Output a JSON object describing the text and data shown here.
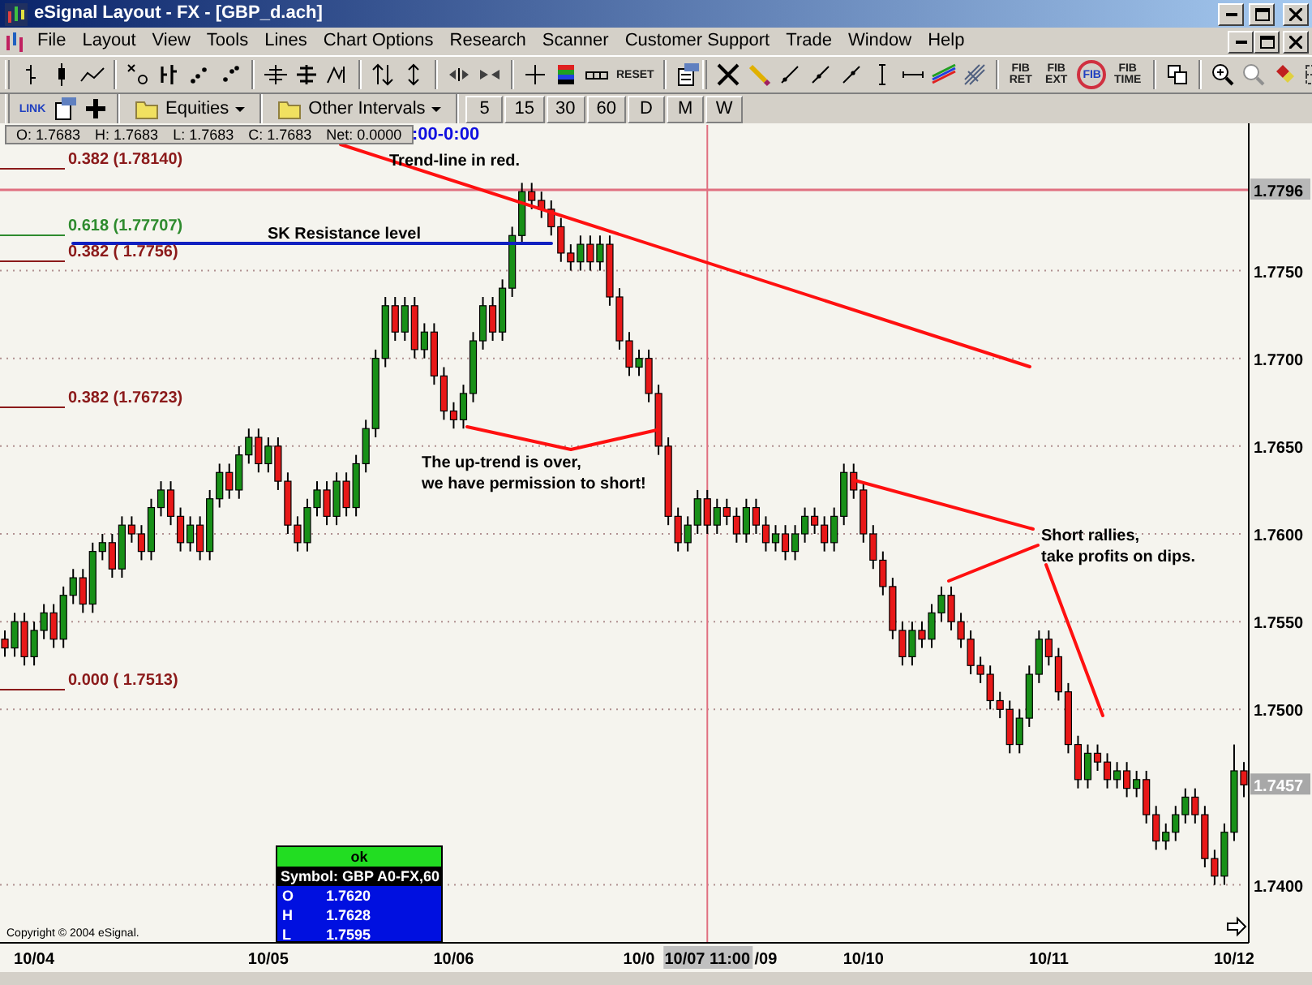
{
  "window": {
    "title": "eSignal Layout - FX - [GBP_d.ach]"
  },
  "menu": [
    "File",
    "Layout",
    "View",
    "Tools",
    "Lines",
    "Chart Options",
    "Research",
    "Scanner",
    "Customer Support",
    "Trade",
    "Window",
    "Help"
  ],
  "chart_toolbar": {
    "reset_label": "RESET"
  },
  "drawing_toolbar": {
    "fib_buttons": [
      "FIB RET",
      "FIB EXT",
      "FIB",
      "FIB TIME"
    ]
  },
  "interval_toolbar": {
    "link_label": "LINK",
    "symbol_list": "Equities",
    "interval_menu": "Other Intervals",
    "intervals": [
      "5",
      "15",
      "30",
      "60",
      "D",
      "M",
      "W"
    ]
  },
  "quote_bar": {
    "items": [
      "O: 1.7683",
      "H: 1.7683",
      "L: 1.7683",
      "C: 1.7683",
      "Net: 0.0000"
    ],
    "time_range": ":00-0:00"
  },
  "chart": {
    "chart_data": {
      "type": "candlestick",
      "grid": true,
      "ylim": [
        1.7367,
        1.7833
      ],
      "categories": [
        null,
        null,
        null,
        "10/04",
        null,
        null,
        null,
        null,
        null,
        null,
        null,
        null,
        null,
        null,
        null,
        null,
        null,
        null,
        null,
        null,
        null,
        null,
        null,
        null,
        null,
        null,
        null,
        "10/05",
        null,
        null,
        null,
        null,
        null,
        null,
        null,
        null,
        null,
        null,
        null,
        null,
        null,
        null,
        null,
        null,
        null,
        null,
        "10/06",
        null,
        null,
        null,
        null,
        null,
        null,
        null,
        null,
        null,
        null,
        null,
        null,
        null,
        null,
        null,
        null,
        null,
        null,
        "10/0",
        null,
        null,
        null,
        null,
        null,
        null,
        null,
        null,
        null,
        null,
        null,
        null,
        "/09",
        null,
        null,
        null,
        null,
        null,
        null,
        null,
        null,
        null,
        "10/10",
        null,
        null,
        null,
        null,
        null,
        null,
        null,
        null,
        null,
        null,
        null,
        null,
        null,
        null,
        null,
        null,
        null,
        null,
        "10/11",
        null,
        null,
        null,
        null,
        null,
        null,
        null,
        null,
        null,
        null,
        null,
        null,
        null,
        null,
        null,
        null,
        null,
        null,
        "10/12",
        null
      ],
      "ohlc": [
        [
          1.754,
          1.7545,
          1.753,
          1.7535
        ],
        [
          1.7535,
          1.7555,
          1.753,
          1.755
        ],
        [
          1.755,
          1.7555,
          1.7525,
          1.753
        ],
        [
          1.753,
          1.755,
          1.7525,
          1.7545
        ],
        [
          1.7545,
          1.756,
          1.754,
          1.7555
        ],
        [
          1.7555,
          1.756,
          1.7535,
          1.754
        ],
        [
          1.754,
          1.757,
          1.7535,
          1.7565
        ],
        [
          1.7565,
          1.758,
          1.756,
          1.7575
        ],
        [
          1.7575,
          1.758,
          1.7555,
          1.756
        ],
        [
          1.756,
          1.7595,
          1.7555,
          1.759
        ],
        [
          1.759,
          1.76,
          1.7585,
          1.7595
        ],
        [
          1.7595,
          1.76,
          1.7575,
          1.758
        ],
        [
          1.758,
          1.761,
          1.7575,
          1.7605
        ],
        [
          1.7605,
          1.761,
          1.7595,
          1.76
        ],
        [
          1.76,
          1.7605,
          1.7585,
          1.759
        ],
        [
          1.759,
          1.762,
          1.7585,
          1.7615
        ],
        [
          1.7615,
          1.763,
          1.761,
          1.7625
        ],
        [
          1.7625,
          1.763,
          1.7605,
          1.761
        ],
        [
          1.761,
          1.7615,
          1.759,
          1.7595
        ],
        [
          1.7595,
          1.761,
          1.759,
          1.7605
        ],
        [
          1.7605,
          1.761,
          1.7585,
          1.759
        ],
        [
          1.759,
          1.7625,
          1.7585,
          1.762
        ],
        [
          1.762,
          1.764,
          1.7615,
          1.7635
        ],
        [
          1.7635,
          1.764,
          1.762,
          1.7625
        ],
        [
          1.7625,
          1.765,
          1.762,
          1.7645
        ],
        [
          1.7645,
          1.766,
          1.764,
          1.7655
        ],
        [
          1.7655,
          1.766,
          1.7635,
          1.764
        ],
        [
          1.764,
          1.7655,
          1.7635,
          1.765
        ],
        [
          1.765,
          1.7655,
          1.7625,
          1.763
        ],
        [
          1.763,
          1.7635,
          1.76,
          1.7605
        ],
        [
          1.7605,
          1.761,
          1.759,
          1.7595
        ],
        [
          1.7595,
          1.762,
          1.759,
          1.7615
        ],
        [
          1.7615,
          1.763,
          1.761,
          1.7625
        ],
        [
          1.7625,
          1.763,
          1.7605,
          1.761
        ],
        [
          1.761,
          1.7635,
          1.7605,
          1.763
        ],
        [
          1.763,
          1.7635,
          1.761,
          1.7615
        ],
        [
          1.7615,
          1.7645,
          1.761,
          1.764
        ],
        [
          1.764,
          1.7665,
          1.7635,
          1.766
        ],
        [
          1.766,
          1.7705,
          1.7655,
          1.77
        ],
        [
          1.77,
          1.7735,
          1.7695,
          1.773
        ],
        [
          1.773,
          1.7735,
          1.771,
          1.7715
        ],
        [
          1.7715,
          1.7735,
          1.771,
          1.773
        ],
        [
          1.773,
          1.7735,
          1.77,
          1.7705
        ],
        [
          1.7705,
          1.772,
          1.77,
          1.7715
        ],
        [
          1.7715,
          1.772,
          1.7685,
          1.769
        ],
        [
          1.769,
          1.7695,
          1.7665,
          1.767
        ],
        [
          1.767,
          1.7675,
          1.766,
          1.7665
        ],
        [
          1.7665,
          1.7685,
          1.766,
          1.768
        ],
        [
          1.768,
          1.7715,
          1.7675,
          1.771
        ],
        [
          1.771,
          1.7735,
          1.7705,
          1.773
        ],
        [
          1.773,
          1.7735,
          1.771,
          1.7715
        ],
        [
          1.7715,
          1.7745,
          1.771,
          1.774
        ],
        [
          1.774,
          1.7775,
          1.7735,
          1.777
        ],
        [
          1.777,
          1.78,
          1.7765,
          1.7795
        ],
        [
          1.7795,
          1.78,
          1.7785,
          1.779
        ],
        [
          1.779,
          1.7795,
          1.778,
          1.7785
        ],
        [
          1.7785,
          1.779,
          1.777,
          1.7775
        ],
        [
          1.7775,
          1.778,
          1.7755,
          1.776
        ],
        [
          1.776,
          1.7765,
          1.775,
          1.7755
        ],
        [
          1.7755,
          1.777,
          1.775,
          1.7765
        ],
        [
          1.7765,
          1.777,
          1.775,
          1.7755
        ],
        [
          1.7755,
          1.777,
          1.775,
          1.7765
        ],
        [
          1.7765,
          1.777,
          1.773,
          1.7735
        ],
        [
          1.7735,
          1.774,
          1.7705,
          1.771
        ],
        [
          1.771,
          1.7715,
          1.769,
          1.7695
        ],
        [
          1.7695,
          1.7705,
          1.769,
          1.77
        ],
        [
          1.77,
          1.7705,
          1.7675,
          1.768
        ],
        [
          1.768,
          1.7685,
          1.7645,
          1.765
        ],
        [
          1.765,
          1.7655,
          1.7605,
          1.761
        ],
        [
          1.761,
          1.7615,
          1.759,
          1.7595
        ],
        [
          1.7595,
          1.761,
          1.759,
          1.7605
        ],
        [
          1.7605,
          1.7625,
          1.76,
          1.762
        ],
        [
          1.762,
          1.7625,
          1.76,
          1.7605
        ],
        [
          1.7605,
          1.762,
          1.76,
          1.7615
        ],
        [
          1.7615,
          1.762,
          1.7605,
          1.761
        ],
        [
          1.761,
          1.7615,
          1.7595,
          1.76
        ],
        [
          1.76,
          1.762,
          1.7595,
          1.7615
        ],
        [
          1.7615,
          1.762,
          1.76,
          1.7605
        ],
        [
          1.7605,
          1.761,
          1.759,
          1.7595
        ],
        [
          1.7595,
          1.7605,
          1.759,
          1.76
        ],
        [
          1.76,
          1.7605,
          1.7585,
          1.759
        ],
        [
          1.759,
          1.7605,
          1.7585,
          1.76
        ],
        [
          1.76,
          1.7615,
          1.7595,
          1.761
        ],
        [
          1.761,
          1.7615,
          1.76,
          1.7605
        ],
        [
          1.7605,
          1.761,
          1.759,
          1.7595
        ],
        [
          1.7595,
          1.7615,
          1.759,
          1.761
        ],
        [
          1.761,
          1.764,
          1.7605,
          1.7635
        ],
        [
          1.7635,
          1.764,
          1.762,
          1.7625
        ],
        [
          1.7625,
          1.763,
          1.7595,
          1.76
        ],
        [
          1.76,
          1.7605,
          1.758,
          1.7585
        ],
        [
          1.7585,
          1.759,
          1.7565,
          1.757
        ],
        [
          1.757,
          1.7575,
          1.754,
          1.7545
        ],
        [
          1.7545,
          1.755,
          1.7525,
          1.753
        ],
        [
          1.753,
          1.755,
          1.7525,
          1.7545
        ],
        [
          1.7545,
          1.755,
          1.7535,
          1.754
        ],
        [
          1.754,
          1.756,
          1.7535,
          1.7555
        ],
        [
          1.7555,
          1.757,
          1.755,
          1.7565
        ],
        [
          1.7565,
          1.757,
          1.7545,
          1.755
        ],
        [
          1.755,
          1.7555,
          1.7535,
          1.754
        ],
        [
          1.754,
          1.7545,
          1.752,
          1.7525
        ],
        [
          1.7525,
          1.753,
          1.7515,
          1.752
        ],
        [
          1.752,
          1.7525,
          1.75,
          1.7505
        ],
        [
          1.7505,
          1.751,
          1.7495,
          1.75
        ],
        [
          1.75,
          1.7505,
          1.7475,
          1.748
        ],
        [
          1.748,
          1.75,
          1.7475,
          1.7495
        ],
        [
          1.7495,
          1.7525,
          1.749,
          1.752
        ],
        [
          1.752,
          1.7545,
          1.7515,
          1.754
        ],
        [
          1.754,
          1.7545,
          1.7525,
          1.753
        ],
        [
          1.753,
          1.7535,
          1.7505,
          1.751
        ],
        [
          1.751,
          1.7515,
          1.7475,
          1.748
        ],
        [
          1.748,
          1.7485,
          1.7455,
          1.746
        ],
        [
          1.746,
          1.748,
          1.7455,
          1.7475
        ],
        [
          1.7475,
          1.748,
          1.7465,
          1.747
        ],
        [
          1.747,
          1.7475,
          1.7455,
          1.746
        ],
        [
          1.746,
          1.747,
          1.7455,
          1.7465
        ],
        [
          1.7465,
          1.747,
          1.745,
          1.7455
        ],
        [
          1.7455,
          1.7465,
          1.745,
          1.746
        ],
        [
          1.746,
          1.7465,
          1.7435,
          1.744
        ],
        [
          1.744,
          1.7445,
          1.742,
          1.7425
        ],
        [
          1.7425,
          1.7435,
          1.742,
          1.743
        ],
        [
          1.743,
          1.7445,
          1.7425,
          1.744
        ],
        [
          1.744,
          1.7455,
          1.7435,
          1.745
        ],
        [
          1.745,
          1.7455,
          1.7435,
          1.744
        ],
        [
          1.744,
          1.7445,
          1.741,
          1.7415
        ],
        [
          1.7415,
          1.742,
          1.74,
          1.7405
        ],
        [
          1.7405,
          1.7435,
          1.74,
          1.743
        ],
        [
          1.743,
          1.748,
          1.7425,
          1.7465
        ],
        [
          1.7465,
          1.747,
          1.745,
          1.7457
        ]
      ],
      "yticks": [
        {
          "value": 1.775,
          "label": "1.7750"
        },
        {
          "value": 1.77,
          "label": "1.7700"
        },
        {
          "value": 1.765,
          "label": "1.7650"
        },
        {
          "value": 1.76,
          "label": "1.7600"
        },
        {
          "value": 1.755,
          "label": "1.7550"
        },
        {
          "value": 1.75,
          "label": "1.7500"
        },
        {
          "value": 1.74,
          "label": "1.7400"
        }
      ],
      "ref_lines": [
        {
          "axis": "y",
          "value": 1.7796,
          "label": "1.7796",
          "color": "#e07080"
        }
      ]
    },
    "last_price": "1.7457",
    "cursor": {
      "label": "10/07 11:00"
    },
    "fib_levels": [
      {
        "label": "0.382 (1.78140)",
        "color": "#8b1a1a"
      },
      {
        "label": "0.618 (1.77707)",
        "color": "#2e8b2e"
      },
      {
        "label": "0.382 ( 1.7756)",
        "color": "#8b1a1a"
      },
      {
        "label": "0.382 (1.76723)",
        "color": "#8b1a1a"
      },
      {
        "label": "0.000 ( 1.7513)",
        "color": "#8b1a1a"
      }
    ],
    "notes": [
      {
        "lines": [
          "Trend-line in red."
        ]
      },
      {
        "lines": [
          "SK Resistance level"
        ]
      },
      {
        "lines": [
          "The up-trend is over,",
          "we have permission to short!"
        ]
      },
      {
        "lines": [
          "Short rallies,",
          "take profits on dips."
        ]
      }
    ]
  },
  "data_window": {
    "status": "ok",
    "symbol": "Symbol: GBP A0-FX,60",
    "rows": [
      {
        "label": "O",
        "value": "1.7620"
      },
      {
        "label": "H",
        "value": "1.7628"
      },
      {
        "label": "L",
        "value": "1.7595"
      }
    ]
  },
  "copyright": "Copyright © 2004 eSignal."
}
